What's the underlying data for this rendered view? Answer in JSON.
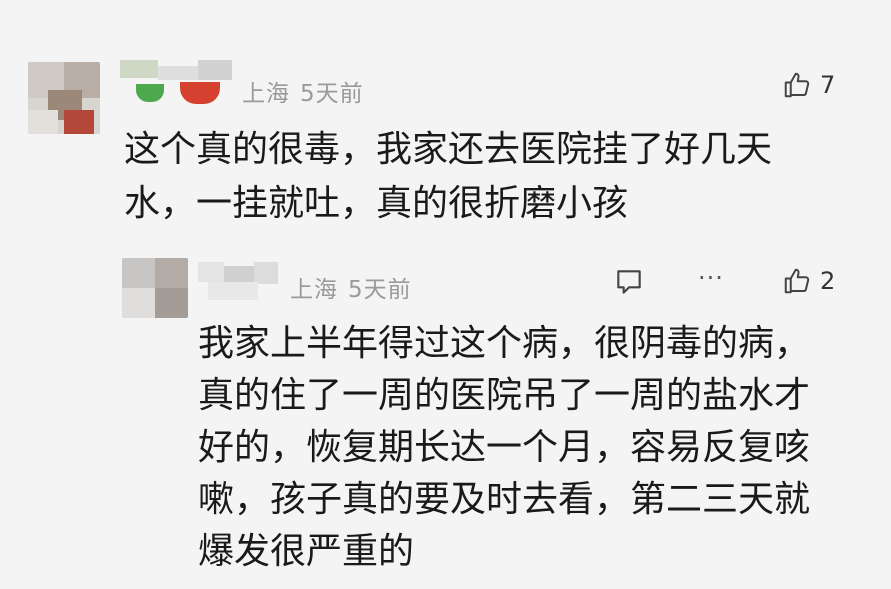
{
  "comment": {
    "location": "上海",
    "time": "5天前",
    "like_count": "7",
    "lines": [
      "这个真的很毒，我家还去医院挂了好几天",
      "水，一挂就吐，真的很折磨小孩"
    ]
  },
  "reply": {
    "location": "上海",
    "time": "5天前",
    "more_label": "···",
    "like_count": "2",
    "lines": [
      "我家上半年得过这个病，很阴毒的病，",
      "真的住了一周的医院吊了一周的盐水才",
      "好的，恢复期长达一个月，容易反复咳",
      "嗽，孩子真的要及时去看，第二三天就",
      "爆发很严重的"
    ]
  },
  "icons": {
    "like": "thumbs-up-icon",
    "reply": "comment-bubble-icon",
    "more": "more-dots-icon"
  }
}
